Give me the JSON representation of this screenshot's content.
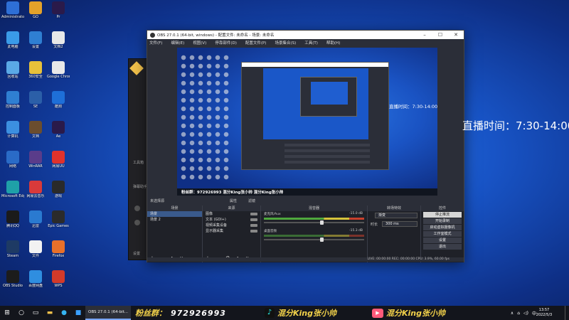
{
  "desktop": {
    "icons": [
      {
        "label": "Administrator",
        "color": "#2e6fd6"
      },
      {
        "label": "此电脑",
        "color": "#3a9be8"
      },
      {
        "label": "回收站",
        "color": "#5aa9e6"
      },
      {
        "label": "控制面板",
        "color": "#2f7fd2"
      },
      {
        "label": "计算机",
        "color": "#3c8fe0"
      },
      {
        "label": "网络",
        "color": "#2a6bc7"
      },
      {
        "label": "Microsoft Edge",
        "color": "#1fa0a8"
      },
      {
        "label": "腾讯QQ",
        "color": "#1b1b1b"
      },
      {
        "label": "Steam",
        "color": "#1e3a64"
      },
      {
        "label": "OBS Studio",
        "color": "#1c1c1c"
      },
      {
        "label": "GO",
        "color": "#e3a22a"
      },
      {
        "label": "设置",
        "color": "#2f7fd2"
      },
      {
        "label": "360安全",
        "color": "#e8c13a"
      },
      {
        "label": "SE",
        "color": "#2b5fa8"
      },
      {
        "label": "文档",
        "color": "#6b4d2e"
      },
      {
        "label": "WinRAR",
        "color": "#5a3c8a"
      },
      {
        "label": "网易云音乐",
        "color": "#d93a3a"
      },
      {
        "label": "迅雷",
        "color": "#2a7ad0"
      },
      {
        "label": "文件",
        "color": "#f2f2f2"
      },
      {
        "label": "百度网盘",
        "color": "#2f8ee0"
      },
      {
        "label": "Pr",
        "color": "#2a1a4a"
      },
      {
        "label": "文档2",
        "color": "#e8e8e8"
      },
      {
        "label": "Google Chrome",
        "color": "#e8e8e8"
      },
      {
        "label": "酷狗",
        "color": "#1e6fd8"
      },
      {
        "label": "Ae",
        "color": "#2a1a4a"
      },
      {
        "label": "网易UU",
        "color": "#e0322c"
      },
      {
        "label": "游戏",
        "color": "#2a2a2a"
      },
      {
        "label": "Epic Games",
        "color": "#2b2b2b"
      },
      {
        "label": "Firefox",
        "color": "#e8702a"
      },
      {
        "label": "WPS",
        "color": "#d23a2a"
      }
    ]
  },
  "bg_app": {
    "items": [
      "工具箱",
      "弹幕助手",
      "设置"
    ]
  },
  "obs": {
    "title": "OBS 27.0.1 (64-bit, windows) - 配置文件: 未命名 - 场景: 未命名",
    "menu": [
      "文件(F)",
      "编辑(E)",
      "视图(V)",
      "停靠部件(D)",
      "配置文件(P)",
      "场景集合(S)",
      "工具(T)",
      "帮助(H)"
    ],
    "preview_time": "直播时间：7:30-14:00",
    "preview_banner": "粉丝群：972926993   混分King张小帅   混分King张小帅",
    "tab_labels": [
      "未选择源",
      "属性",
      "滤镜"
    ],
    "docks": {
      "scenes": {
        "header": "场景",
        "items": [
          "场景",
          "场景 2"
        ]
      },
      "sources": {
        "header": "来源",
        "items": [
          "图像",
          "文本 (GDI+)",
          "视频采集设备",
          "显示器采集"
        ]
      },
      "mixer": {
        "header": "混音器",
        "channels": [
          {
            "name": "麦克风/Aux",
            "db": "-15.0 dB"
          },
          {
            "name": "桌面音频",
            "db": "-15.3 dB"
          }
        ]
      },
      "transitions": {
        "header": "转场特效",
        "type": "渐变",
        "duration_label": "时长",
        "duration": "300 ms"
      },
      "controls": {
        "header": "控件",
        "buttons": [
          "停止推流",
          "开始录制",
          "启动虚拟摄像机",
          "工作室模式",
          "设置",
          "退出"
        ]
      }
    },
    "status": "LIVE: 00:00:00   REC: 00:00:00   CPU: 3.9%, 60.00 fps"
  },
  "live_time": "直播时间：7:30-14:00",
  "taskbar": {
    "obs_button": "OBS 27.0.1 (64-bit...",
    "fans_label": "粉丝群：",
    "fans_number": "972926993",
    "tiktok_text": "混分King张小帅",
    "kuai_text": "混分King张小帅",
    "time": "13:57",
    "date": "2022/5/3"
  }
}
